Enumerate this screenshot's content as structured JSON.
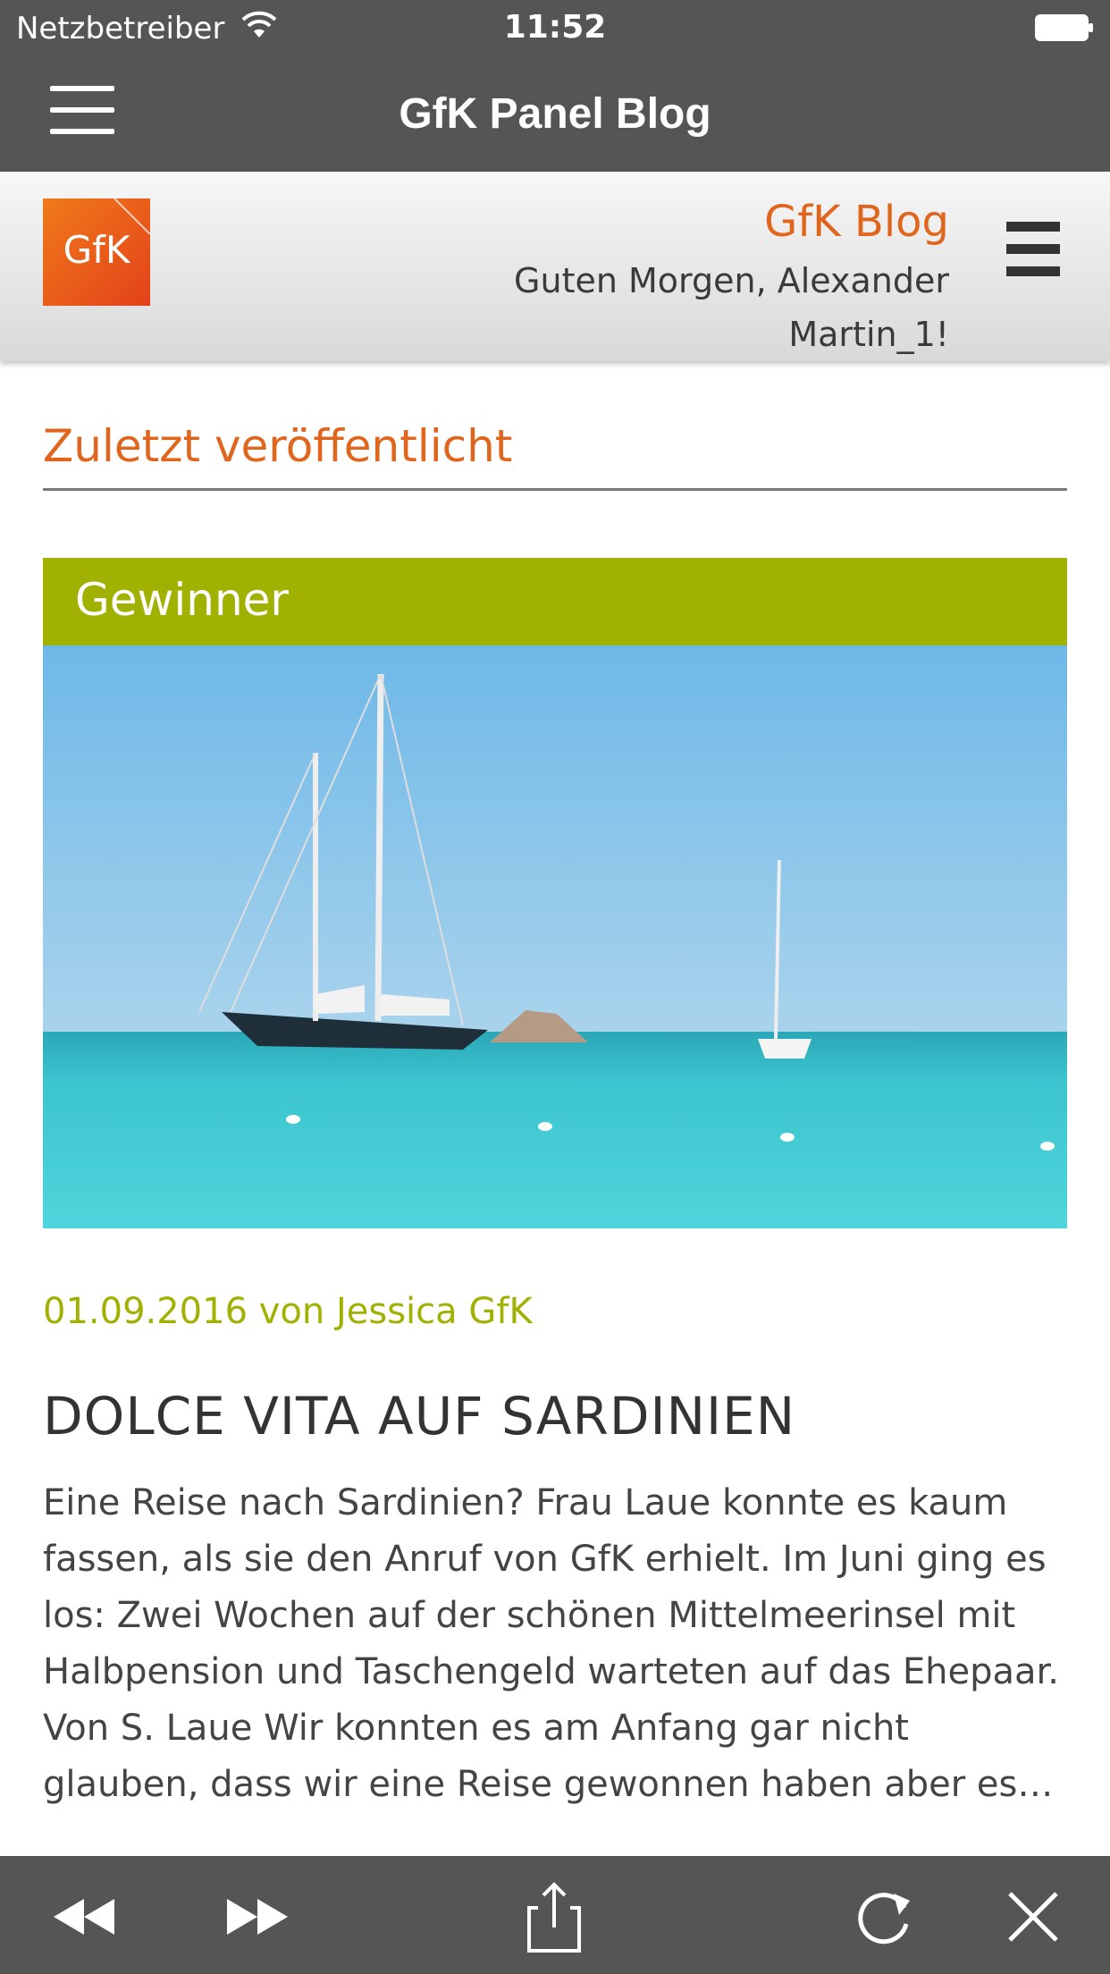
{
  "status_bar": {
    "carrier": "Netzbetreiber",
    "time": "11:52",
    "icons": [
      "wifi-icon",
      "battery-icon"
    ]
  },
  "app_bar": {
    "title": "GfK Panel Blog",
    "menu_icon": "hamburger-menu-icon"
  },
  "site_header": {
    "logo_text": "GfK",
    "blog_link": "GfK Blog",
    "greeting": "Guten Morgen, Alexander Martin_1!",
    "menu_icon": "hamburger-menu-icon"
  },
  "section": {
    "title": "Zuletzt veröffentlicht"
  },
  "post": {
    "category": "Gewinner",
    "image_icon": "sailboat-photo",
    "meta": "01.09.2016 von Jessica GfK",
    "title": "DOLCE VITA AUF SARDINIEN",
    "excerpt": "Eine Reise nach Sardinien? Frau Laue konnte es kaum fassen, als sie den Anruf von GfK erhielt. Im Juni ging es los: Zwei Wochen auf der schönen Mittelmeerinsel mit Halbpension und Taschengeld warteten auf das Ehepaar. Von S. Laue Wir konnten es am Anfang gar nicht glauben, dass wir eine Reise gewonnen haben aber es…"
  },
  "toolbar": {
    "icons": [
      "back-icon",
      "forward-icon",
      "share-icon",
      "reload-icon",
      "close-icon"
    ]
  },
  "colors": {
    "accent_orange": "#e0661e",
    "accent_green": "#a1b102",
    "bar_gray": "#555555"
  }
}
